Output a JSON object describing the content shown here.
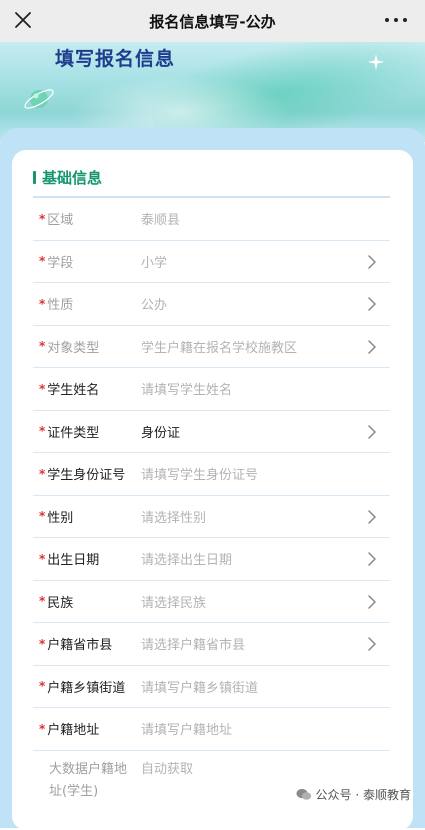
{
  "topbar": {
    "title": "报名信息填写-公办"
  },
  "banner": {
    "heading": "填写报名信息"
  },
  "section": {
    "title": "基础信息"
  },
  "rows": [
    {
      "label": "区域",
      "value": "泰顺县",
      "required": true,
      "disabled": true,
      "chevron": false,
      "filled": false
    },
    {
      "label": "学段",
      "value": "小学",
      "required": true,
      "disabled": true,
      "chevron": true,
      "filled": false
    },
    {
      "label": "性质",
      "value": "公办",
      "required": true,
      "disabled": true,
      "chevron": true,
      "filled": false
    },
    {
      "label": "对象类型",
      "value": "学生户籍在报名学校施教区",
      "required": true,
      "disabled": true,
      "chevron": true,
      "filled": false
    },
    {
      "label": "学生姓名",
      "value": "请填写学生姓名",
      "required": true,
      "disabled": false,
      "chevron": false,
      "filled": false
    },
    {
      "label": "证件类型",
      "value": "身份证",
      "required": true,
      "disabled": false,
      "chevron": true,
      "filled": true
    },
    {
      "label": "学生身份证号",
      "value": "请填写学生身份证号",
      "required": true,
      "disabled": false,
      "chevron": false,
      "filled": false
    },
    {
      "label": "性别",
      "value": "请选择性别",
      "required": true,
      "disabled": false,
      "chevron": true,
      "filled": false
    },
    {
      "label": "出生日期",
      "value": "请选择出生日期",
      "required": true,
      "disabled": false,
      "chevron": true,
      "filled": false
    },
    {
      "label": "民族",
      "value": "请选择民族",
      "required": true,
      "disabled": false,
      "chevron": true,
      "filled": false
    },
    {
      "label": "户籍省市县",
      "value": "请选择户籍省市县",
      "required": true,
      "disabled": false,
      "chevron": true,
      "filled": false
    },
    {
      "label": "户籍乡镇街道",
      "value": "请填写户籍乡镇街道",
      "required": true,
      "disabled": false,
      "chevron": false,
      "filled": false
    },
    {
      "label": "户籍地址",
      "value": "请填写户籍地址",
      "required": true,
      "disabled": false,
      "chevron": false,
      "filled": false
    }
  ],
  "last_row": {
    "label_line1": "大数据户籍地",
    "label_line2": "址(学生)",
    "value": "自动获取"
  },
  "watermark": {
    "text": "公众号 · 泰顺教育"
  },
  "colors": {
    "accent": "#15966f",
    "required": "#e0302f",
    "heading": "#1d3d8f"
  },
  "icons": {
    "close": "close-icon",
    "more": "more-icon",
    "chevron": "chevron-right-icon",
    "wechat": "wechat-icon"
  }
}
